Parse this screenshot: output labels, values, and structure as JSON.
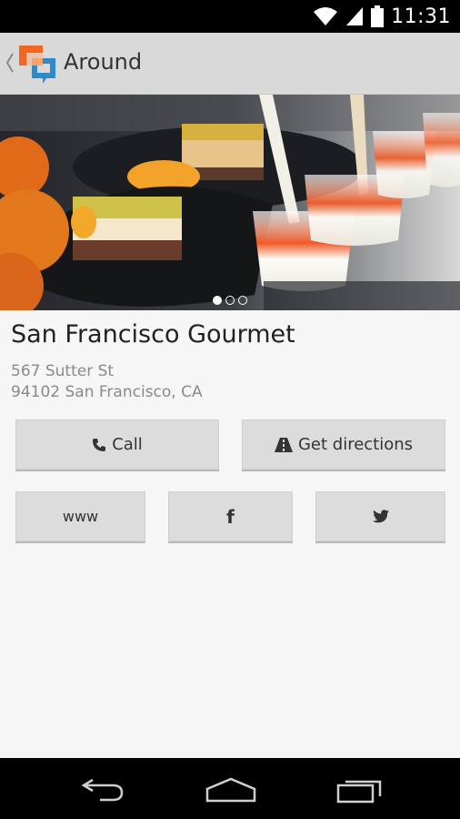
{
  "status_bar": {
    "time": "11:31",
    "icons": [
      "wifi-icon",
      "signal-icon",
      "battery-icon"
    ]
  },
  "action_bar": {
    "title": "Around",
    "logo": "around-logo-icon"
  },
  "hero": {
    "pager": {
      "count": 3,
      "active_index": 0
    }
  },
  "place": {
    "name": "San Francisco Gourmet",
    "address_line1": "567 Sutter St",
    "address_line2": "94102 San Francisco, CA"
  },
  "actions": {
    "call_label": "Call",
    "directions_label": "Get directions",
    "www_label": "www",
    "facebook_label": "f"
  },
  "colors": {
    "action_bar_bg": "#d9d9d9",
    "button_bg": "#dcdcdc",
    "logo_orange": "#f26522",
    "logo_blue": "#2e8bc9"
  }
}
